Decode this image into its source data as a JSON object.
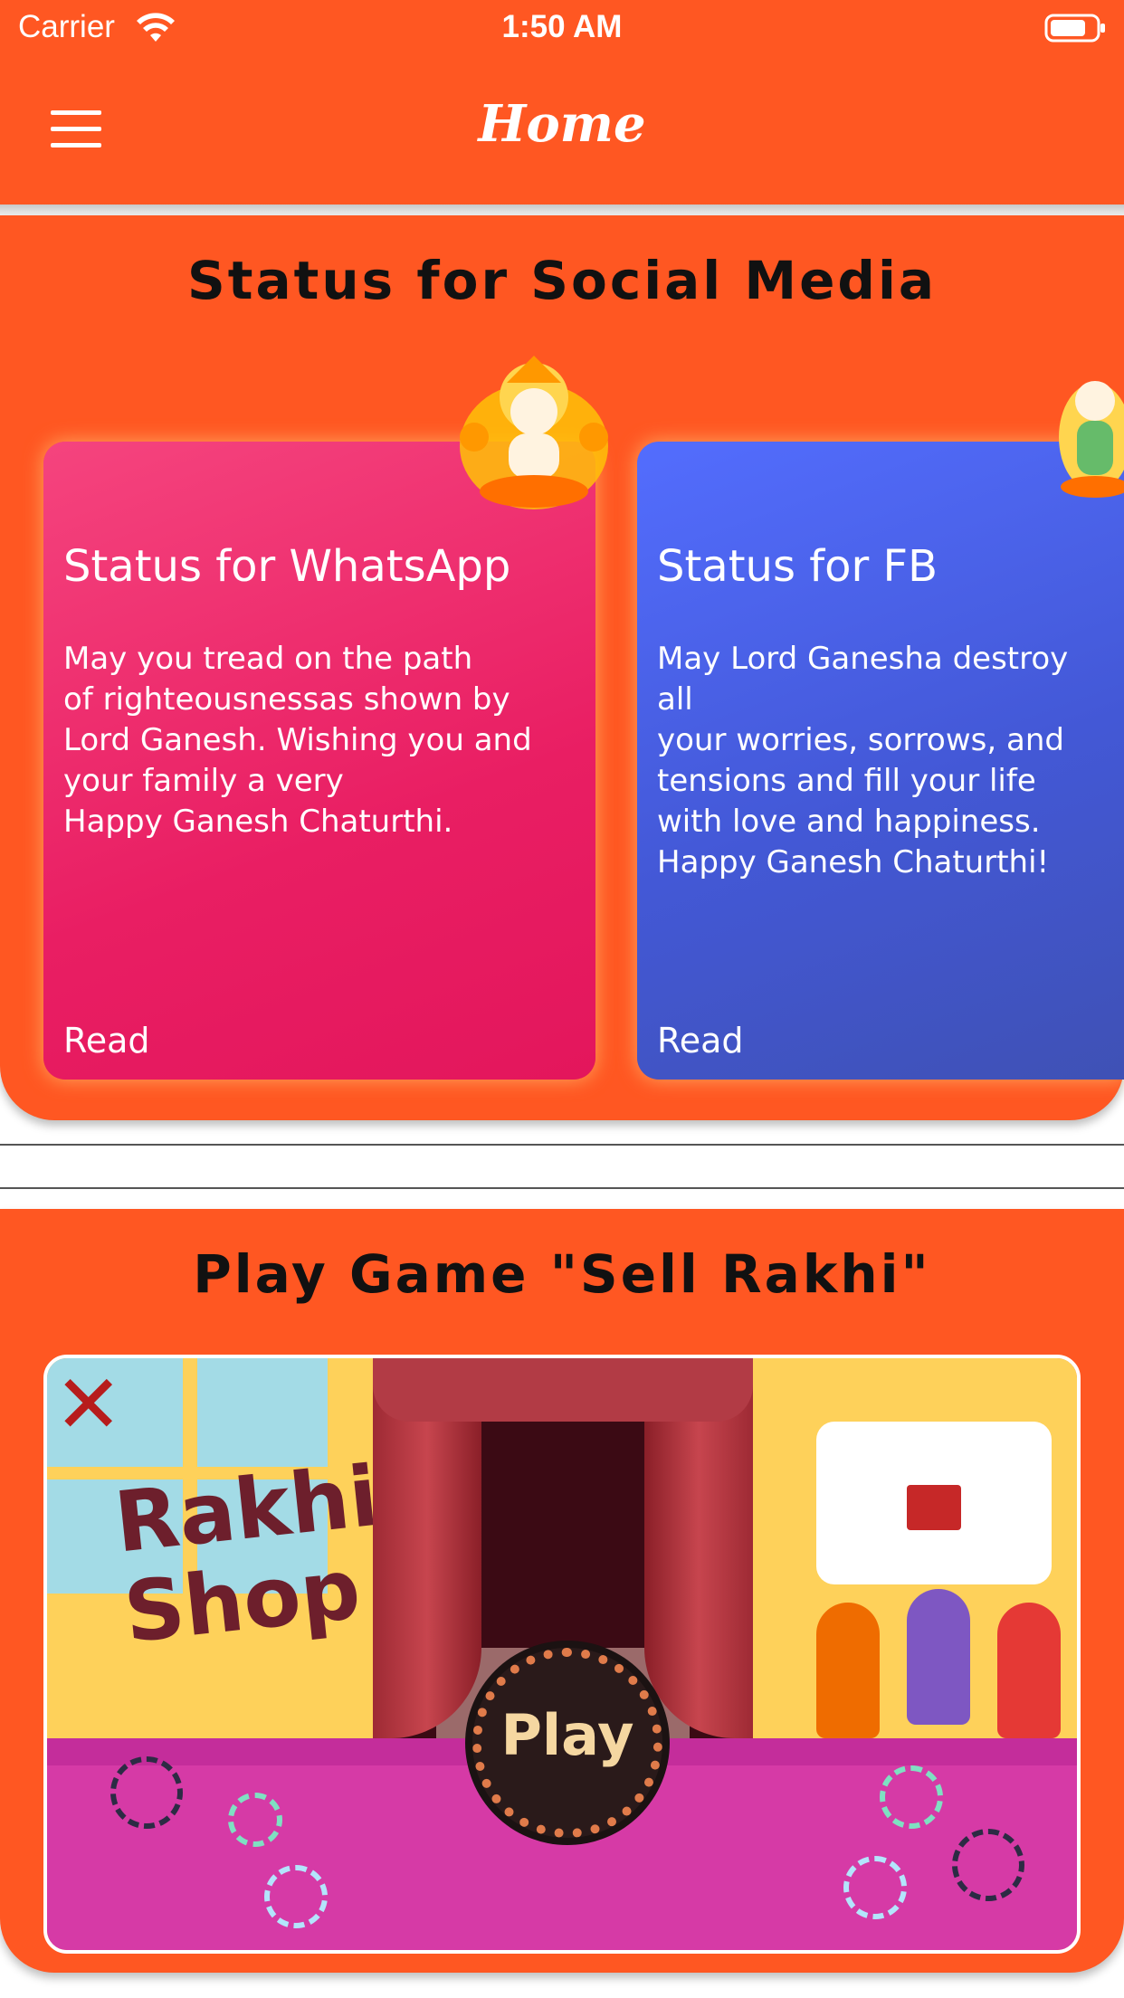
{
  "status_bar": {
    "carrier": "Carrier",
    "time": "1:50 AM",
    "wifi_icon": "wifi-icon",
    "battery_icon": "battery-icon"
  },
  "navbar": {
    "title": "Home",
    "menu_icon": "hamburger-menu-icon"
  },
  "colors": {
    "primary": "#ff5722",
    "card_pink": "#e91e63",
    "card_blue": "#3f51b5",
    "text_dark": "#111111"
  },
  "section_social": {
    "title": "Status for Social Media",
    "cards": [
      {
        "title": "Status for WhatsApp",
        "body": "May you tread on the path\nof righteousnessas shown by\nLord Ganesh. Wishing you and\nyour family a very\nHappy Ganesh Chaturthi.",
        "action": "Read",
        "icon": "ganesha-icon"
      },
      {
        "title": "Status for FB",
        "body": "May Lord Ganesha destroy all\nyour worries, sorrows, and\ntensions and fill your life\nwith love and happiness.\nHappy Ganesh Chaturthi!",
        "action": "Read",
        "icon": "ganesha-icon"
      }
    ]
  },
  "section_game": {
    "title": "Play Game \"Sell Rakhi\"",
    "banner": {
      "shop_text": "Rakhi\nShop",
      "play_text": "Play",
      "close_icon": "close-icon"
    }
  }
}
